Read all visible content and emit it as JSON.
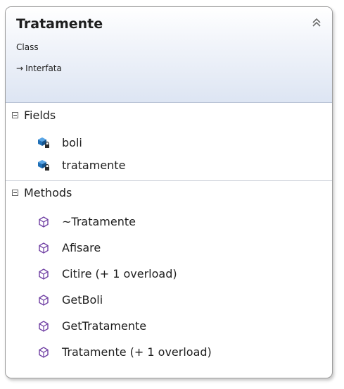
{
  "class_box": {
    "title": "Tratamente",
    "subtitle": "Class",
    "inherits_label": "Interfata",
    "inherits_arrow": "→"
  },
  "fields": {
    "label": "Fields",
    "items": [
      {
        "name": "boli",
        "icon": "private-field-icon"
      },
      {
        "name": "tratamente",
        "icon": "private-field-icon"
      }
    ]
  },
  "methods": {
    "label": "Methods",
    "items": [
      {
        "name": "~Tratamente",
        "icon": "method-icon"
      },
      {
        "name": "Afisare",
        "icon": "method-icon"
      },
      {
        "name": "Citire (+ 1 overload)",
        "icon": "method-icon"
      },
      {
        "name": "GetBoli",
        "icon": "method-icon"
      },
      {
        "name": "GetTratamente",
        "icon": "method-icon"
      },
      {
        "name": "Tratamente (+ 1 overload)",
        "icon": "method-icon"
      }
    ]
  },
  "colors": {
    "field_icon": "#1f6fb6",
    "method_icon": "#6f3fa3"
  }
}
